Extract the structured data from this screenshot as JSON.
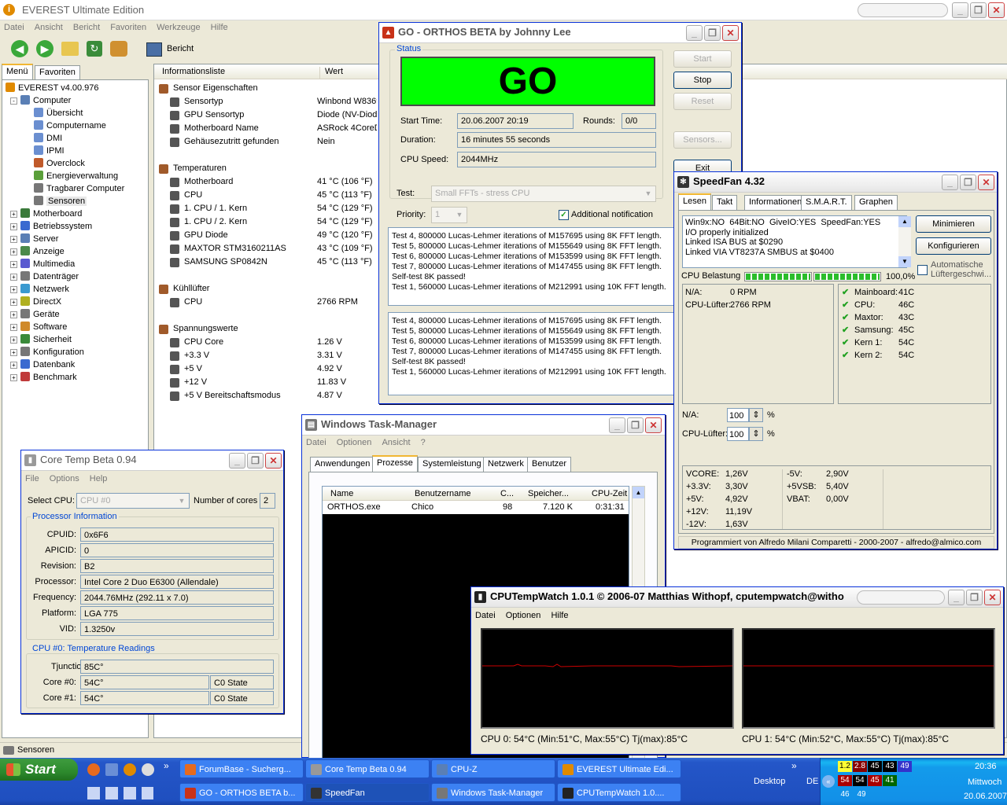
{
  "everest": {
    "title": "EVEREST Ultimate Edition",
    "menu": [
      "Datei",
      "Ansicht",
      "Bericht",
      "Favoriten",
      "Werkzeuge",
      "Hilfe"
    ],
    "report_label": "Bericht",
    "tabs": [
      "Menü",
      "Favoriten"
    ],
    "tree": [
      {
        "label": "EVEREST v4.00.976",
        "level": 0,
        "icon": "info-icon",
        "expander": ""
      },
      {
        "label": "Computer",
        "level": 1,
        "icon": "computer-icon",
        "expander": "-"
      },
      {
        "label": "Übersicht",
        "level": 2,
        "icon": "page-icon",
        "expander": ""
      },
      {
        "label": "Computername",
        "level": 2,
        "icon": "page-icon",
        "expander": ""
      },
      {
        "label": "DMI",
        "level": 2,
        "icon": "page-icon",
        "expander": ""
      },
      {
        "label": "IPMI",
        "level": 2,
        "icon": "page-icon",
        "expander": ""
      },
      {
        "label": "Overclock",
        "level": 2,
        "icon": "overclock-icon",
        "expander": ""
      },
      {
        "label": "Energieverwaltung",
        "level": 2,
        "icon": "power-icon",
        "expander": ""
      },
      {
        "label": "Tragbarer Computer",
        "level": 2,
        "icon": "laptop-icon",
        "expander": ""
      },
      {
        "label": "Sensoren",
        "level": 2,
        "icon": "sensor-icon",
        "expander": "",
        "selected": true
      },
      {
        "label": "Motherboard",
        "level": 1,
        "icon": "board-icon",
        "expander": "+"
      },
      {
        "label": "Betriebssystem",
        "level": 1,
        "icon": "os-icon",
        "expander": "+"
      },
      {
        "label": "Server",
        "level": 1,
        "icon": "server-icon",
        "expander": "+"
      },
      {
        "label": "Anzeige",
        "level": 1,
        "icon": "display-icon",
        "expander": "+"
      },
      {
        "label": "Multimedia",
        "level": 1,
        "icon": "multimedia-icon",
        "expander": "+"
      },
      {
        "label": "Datenträger",
        "level": 1,
        "icon": "disk-icon",
        "expander": "+"
      },
      {
        "label": "Netzwerk",
        "level": 1,
        "icon": "network-icon",
        "expander": "+"
      },
      {
        "label": "DirectX",
        "level": 1,
        "icon": "directx-icon",
        "expander": "+"
      },
      {
        "label": "Geräte",
        "level": 1,
        "icon": "devices-icon",
        "expander": "+"
      },
      {
        "label": "Software",
        "level": 1,
        "icon": "software-icon",
        "expander": "+"
      },
      {
        "label": "Sicherheit",
        "level": 1,
        "icon": "security-icon",
        "expander": "+"
      },
      {
        "label": "Konfiguration",
        "level": 1,
        "icon": "config-icon",
        "expander": "+"
      },
      {
        "label": "Datenbank",
        "level": 1,
        "icon": "database-icon",
        "expander": "+"
      },
      {
        "label": "Benchmark",
        "level": 1,
        "icon": "benchmark-icon",
        "expander": "+"
      }
    ],
    "columns": [
      "Informationsliste",
      "Wert"
    ],
    "rows": [
      {
        "label": "Sensor Eigenschaften",
        "value": "",
        "type": "group"
      },
      {
        "label": "Sensortyp",
        "value": "Winbond W8369",
        "type": "item"
      },
      {
        "label": "GPU Sensortyp",
        "value": "Diode  (NV-Diode",
        "type": "item"
      },
      {
        "label": "Motherboard Name",
        "value": "ASRock 4CoreDu",
        "type": "item"
      },
      {
        "label": "Gehäusezutritt gefunden",
        "value": "Nein",
        "type": "item"
      },
      {
        "label": "",
        "value": "",
        "type": "gap"
      },
      {
        "label": "Temperaturen",
        "value": "",
        "type": "group"
      },
      {
        "label": "Motherboard",
        "value": "41 °C  (106 °F)",
        "type": "item"
      },
      {
        "label": "CPU",
        "value": "45 °C  (113 °F)",
        "type": "item"
      },
      {
        "label": "1. CPU / 1. Kern",
        "value": "54 °C  (129 °F)",
        "type": "item"
      },
      {
        "label": "1. CPU / 2. Kern",
        "value": "54 °C  (129 °F)",
        "type": "item"
      },
      {
        "label": "GPU Diode",
        "value": "49 °C  (120 °F)",
        "type": "item"
      },
      {
        "label": "MAXTOR STM3160211AS",
        "value": "43 °C  (109 °F)",
        "type": "item"
      },
      {
        "label": "SAMSUNG SP0842N",
        "value": "45 °C  (113 °F)",
        "type": "item"
      },
      {
        "label": "",
        "value": "",
        "type": "gap"
      },
      {
        "label": "Kühllüfter",
        "value": "",
        "type": "group"
      },
      {
        "label": "CPU",
        "value": "2766 RPM",
        "type": "item"
      },
      {
        "label": "",
        "value": "",
        "type": "gap"
      },
      {
        "label": "Spannungswerte",
        "value": "",
        "type": "group"
      },
      {
        "label": "CPU Core",
        "value": "1.26 V",
        "type": "item"
      },
      {
        "label": "+3.3 V",
        "value": "3.31 V",
        "type": "item"
      },
      {
        "label": "+5 V",
        "value": "4.92 V",
        "type": "item"
      },
      {
        "label": "+12 V",
        "value": "11.83 V",
        "type": "item"
      },
      {
        "label": "+5 V Bereitschaftsmodus",
        "value": "4.87 V",
        "type": "item"
      }
    ],
    "status": "Sensoren"
  },
  "orthos": {
    "title": "GO - ORTHOS BETA by Johnny Lee",
    "status_label": "Status",
    "status_text": "GO",
    "status_color": "#00ff00",
    "start_time_label": "Start Time:",
    "start_time": "20.06.2007 20:19",
    "rounds_label": "Rounds:",
    "rounds": "0/0",
    "duration_label": "Duration:",
    "duration": "16 minutes 55 seconds",
    "cpu_speed_label": "CPU Speed:",
    "cpu_speed": "2044MHz",
    "test_label": "Test:",
    "test_value": "Small FFTs - stress CPU",
    "priority_label": "Priority:",
    "priority_value": "1",
    "notification_label": "Additional notification",
    "buttons": {
      "start": "Start",
      "stop": "Stop",
      "reset": "Reset",
      "sensors": "Sensors...",
      "exit": "Exit"
    },
    "log1": [
      "Test 4, 800000 Lucas-Lehmer iterations of M157695 using 8K FFT length.",
      "Test 5, 800000 Lucas-Lehmer iterations of M155649 using 8K FFT length.",
      "Test 6, 800000 Lucas-Lehmer iterations of M153599 using 8K FFT length.",
      "Test 7, 800000 Lucas-Lehmer iterations of M147455 using 8K FFT length.",
      "Self-test 8K passed!",
      "Test 1, 560000 Lucas-Lehmer iterations of M212991 using 10K FFT length."
    ],
    "log2": [
      "Test 4, 800000 Lucas-Lehmer iterations of M157695 using 8K FFT length.",
      "Test 5, 800000 Lucas-Lehmer iterations of M155649 using 8K FFT length.",
      "Test 6, 800000 Lucas-Lehmer iterations of M153599 using 8K FFT length.",
      "Test 7, 800000 Lucas-Lehmer iterations of M147455 using 8K FFT length.",
      "Self-test 8K passed!",
      "Test 1, 560000 Lucas-Lehmer iterations of M212991 using 10K FFT length."
    ]
  },
  "speedfan": {
    "title": "SpeedFan 4.32",
    "tabs": [
      "Lesen",
      "Takt",
      "Informationen",
      "S.M.A.R.T.",
      "Graphen"
    ],
    "log": [
      "Win9x:NO  64Bit:NO  GiveIO:YES  SpeedFan:YES",
      "I/O properly initialized",
      "Linked ISA BUS at $0290",
      "Linked VIA VT8237A SMBUS at $0400"
    ],
    "minimize_label": "Minimieren",
    "configure_label": "Konfigurieren",
    "auto_fan_label": "Automatische Lüftergeschwi...",
    "cpu_load_label": "CPU Belastung",
    "cpu_load": "100,0%",
    "cpu_load_fraction": 1.0,
    "fans": [
      {
        "label": "N/A:",
        "value": "0 RPM"
      },
      {
        "label": "CPU-Lüfter:",
        "value": "2766 RPM"
      }
    ],
    "temps": [
      {
        "label": "Mainboard:",
        "value": "41C"
      },
      {
        "label": "CPU:",
        "value": "46C"
      },
      {
        "label": "Maxtor:",
        "value": "43C"
      },
      {
        "label": "Samsung:",
        "value": "45C"
      },
      {
        "label": "Kern 1:",
        "value": "54C"
      },
      {
        "label": "Kern 2:",
        "value": "54C"
      }
    ],
    "speeds": [
      {
        "label": "N/A:",
        "value": "100",
        "unit": "%"
      },
      {
        "label": "CPU-Lüfter:",
        "value": "100",
        "unit": "%"
      }
    ],
    "volts_left": [
      {
        "label": "VCORE:",
        "value": "1,26V"
      },
      {
        "label": "+3.3V:",
        "value": "3,30V"
      },
      {
        "label": "+5V:",
        "value": "4,92V"
      },
      {
        "label": "+12V:",
        "value": "11,19V"
      },
      {
        "label": "-12V:",
        "value": "1,63V"
      }
    ],
    "volts_right": [
      {
        "label": "-5V:",
        "value": "2,90V"
      },
      {
        "label": "+5VSB:",
        "value": "5,40V"
      },
      {
        "label": "VBAT:",
        "value": "0,00V"
      }
    ],
    "footer": "Programmiert von Alfredo Milani Comparetti - 2000-2007 - alfredo@almico.com"
  },
  "coretemp": {
    "title": "Core Temp Beta 0.94",
    "menu": [
      "File",
      "Options",
      "Help"
    ],
    "select_cpu_label": "Select CPU:",
    "select_cpu_value": "CPU #0",
    "cores_label": "Number of cores",
    "cores_value": "2",
    "proc_group": "Processor Information",
    "proc_fields": [
      {
        "label": "CPUID:",
        "value": "0x6F6"
      },
      {
        "label": "APICID:",
        "value": "0"
      },
      {
        "label": "Revision:",
        "value": "B2"
      },
      {
        "label": "Processor:",
        "value": "Intel Core 2 Duo E6300 (Allendale)"
      },
      {
        "label": "Frequency:",
        "value": "2044.76MHz (292.11 x 7.0)"
      },
      {
        "label": "Platform:",
        "value": "LGA 775"
      },
      {
        "label": "VID:",
        "value": "1.3250v"
      }
    ],
    "temp_group": "CPU #0: Temperature Readings",
    "tjunction_label": "Tjunction:",
    "tjunction_value": "85C°",
    "cores": [
      {
        "label": "Core #0:",
        "value": "54C°",
        "state": "C0 State"
      },
      {
        "label": "Core #1:",
        "value": "54C°",
        "state": "C0 State"
      }
    ]
  },
  "taskmgr": {
    "title": "Windows Task-Manager",
    "menu": [
      "Datei",
      "Optionen",
      "Ansicht",
      "?"
    ],
    "tabs": [
      "Anwendungen",
      "Prozesse",
      "Systemleistung",
      "Netzwerk",
      "Benutzer"
    ],
    "columns": [
      "Name",
      "Benutzername",
      "C...",
      "Speicher...",
      "CPU-Zeit"
    ],
    "row": {
      "name": "ORTHOS.exe",
      "user": "Chico",
      "cpu": "98",
      "mem": "7.120 K",
      "time": "0:31:31"
    }
  },
  "cputempwatch": {
    "title": "CPUTempWatch 1.0.1 © 2006-07 Matthias Withopf, cputempwatch@witho",
    "menu": [
      "Datei",
      "Optionen",
      "Hilfe"
    ],
    "cpu0": "CPU 0: 54°C (Min:51°C, Max:55°C) Tj(max):85°C",
    "cpu1": "CPU 1: 54°C (Min:52°C, Max:55°C) Tj(max):85°C",
    "line_color": "#cc0000"
  },
  "taskbar": {
    "start_label": "Start",
    "tasks_row1": [
      "ForumBase - Sucherg...",
      "Core Temp Beta 0.94",
      "CPU-Z",
      "EVEREST Ultimate Edi..."
    ],
    "tasks_row2": [
      "GO - ORTHOS BETA b...",
      "SpeedFan",
      "Windows Task-Manager",
      "CPUTempWatch 1.0...."
    ],
    "desktop_label": "Desktop",
    "lang": "DE",
    "clock_time": "20:36",
    "clock_day": "Mittwoch",
    "clock_date": "20.06.2007",
    "tray_row1": [
      "1.2",
      "2.8",
      "45",
      "43",
      "49"
    ],
    "tray_row2": [
      "54",
      "54",
      "45",
      "41"
    ],
    "tray_row3": [
      "46",
      "49"
    ]
  }
}
